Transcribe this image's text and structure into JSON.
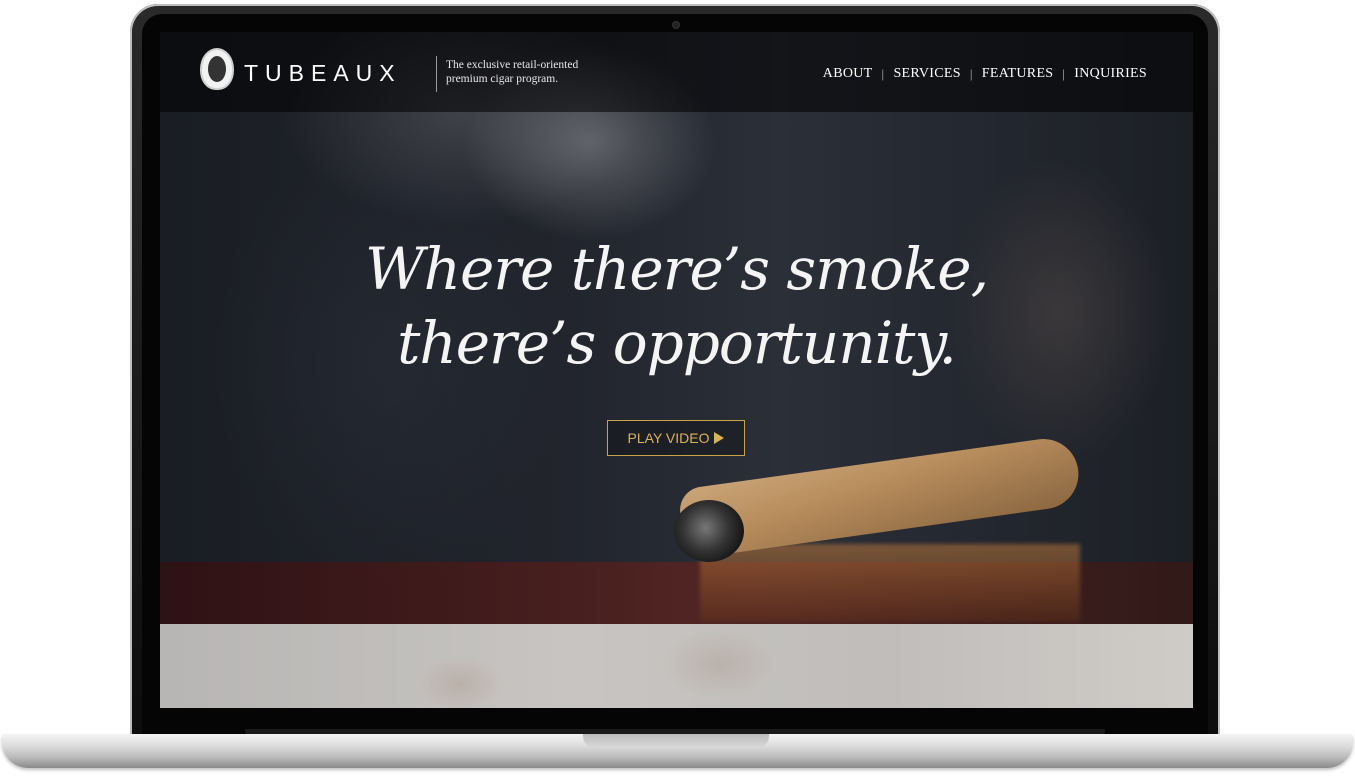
{
  "header": {
    "brand": "TUBEAUX",
    "tagline_line1": "The exclusive retail-oriented",
    "tagline_line2": "premium cigar program."
  },
  "nav": {
    "items": [
      "ABOUT",
      "SERVICES",
      "FEATURES",
      "INQUIRIES"
    ],
    "separator": "|"
  },
  "hero": {
    "headline_line1": "Where there’s smoke,",
    "headline_line2": "there’s opportunity.",
    "play_button": "PLAY VIDEO",
    "play_icon": "play-triangle-icon",
    "accent_color": "#d9b25c"
  }
}
